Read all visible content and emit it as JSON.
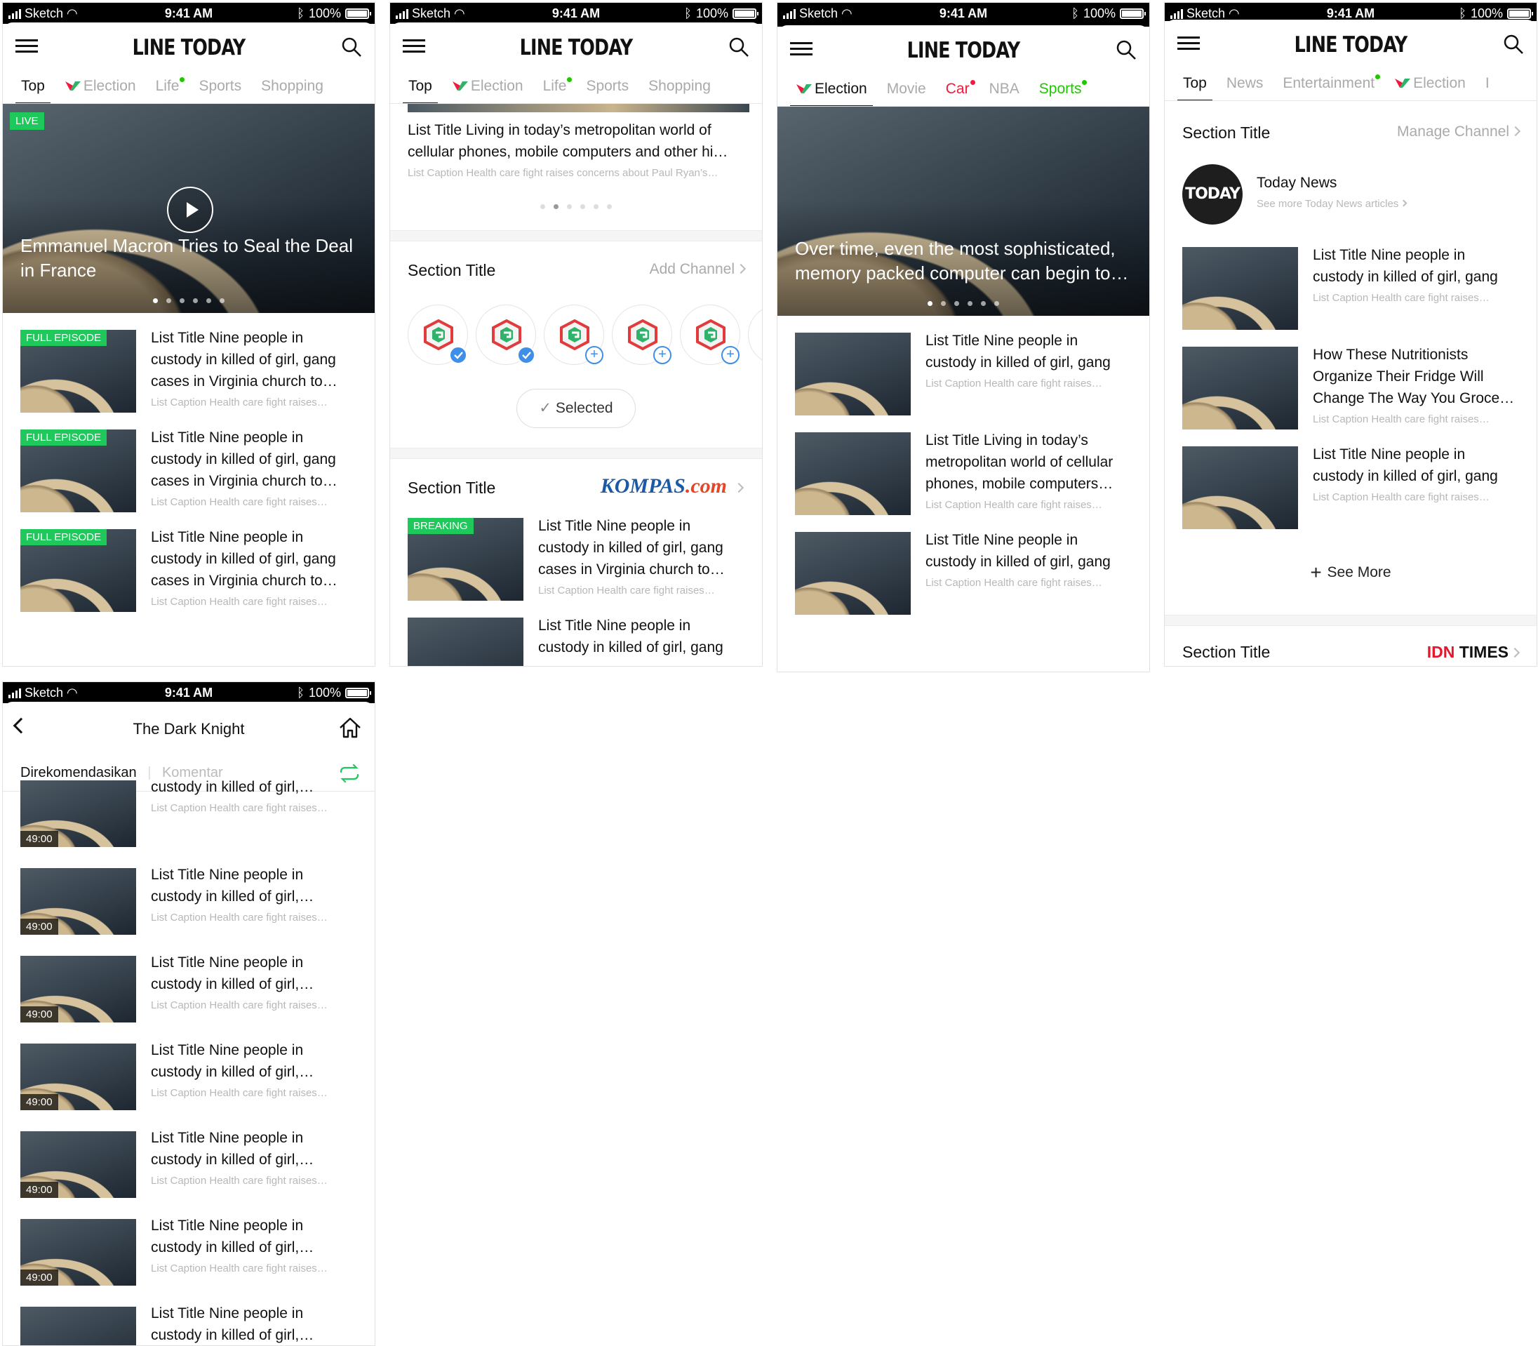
{
  "status": {
    "carrier": "Sketch",
    "time": "9:41 AM",
    "battery": "100%"
  },
  "brand": "LINE TODAY",
  "p1": {
    "tabs": [
      {
        "label": "Top",
        "active": true
      },
      {
        "label": "Election",
        "logo": true
      },
      {
        "label": "Life",
        "dot": "green"
      },
      {
        "label": "Sports"
      },
      {
        "label": "Shopping"
      }
    ],
    "hero": {
      "badge": "LIVE",
      "title": "Emmanuel Macron Tries to Seal the Deal in France",
      "dots": 6,
      "active_dot": 0
    },
    "items": [
      {
        "badge": "FULL EPISODE",
        "title": "List Title Nine people in custody in killed of girl, gang cases in Virginia church to…",
        "caption": "List Caption Health care fight raises…"
      },
      {
        "badge": "FULL EPISODE",
        "title": "List Title Nine people in custody in killed of girl, gang cases in Virginia church to…",
        "caption": "List Caption Health care fight raises…"
      },
      {
        "badge": "FULL EPISODE",
        "title": "List Title Nine people in custody in killed of girl, gang cases in Virginia church to…",
        "caption": "List Caption Health care fight raises…"
      }
    ]
  },
  "p2": {
    "tabs": [
      {
        "label": "Top",
        "active": true
      },
      {
        "label": "Election",
        "logo": true
      },
      {
        "label": "Life",
        "dot": "green"
      },
      {
        "label": "Sports"
      },
      {
        "label": "Shopping"
      }
    ],
    "top_item": {
      "title": "List Title Living in today’s metropolitan world of cellular phones, mobile computers and other hi…",
      "caption": "List Caption Health care fight raises concerns about Paul Ryan’s…",
      "dots": 6,
      "active_dot": 1
    },
    "section1": {
      "title": "Section Title",
      "action": "Add Channel",
      "selected_label": "Selected"
    },
    "section2": {
      "title": "Section Title",
      "publisher_a": "KOMPAS",
      "publisher_b": ".com"
    },
    "items": [
      {
        "badge": "BREAKING",
        "title": "List Title Nine people in custody in killed of girl, gang cases in Virginia church to…",
        "caption": "List Caption Health care fight raises…"
      },
      {
        "title": "List Title Nine people in custody in killed of girl, gang",
        "caption": ""
      }
    ]
  },
  "p3": {
    "tabs": [
      {
        "label": "Election",
        "active": true,
        "logo": true
      },
      {
        "label": "Movie"
      },
      {
        "label": "Car",
        "dot": "red",
        "color": "#f0193e"
      },
      {
        "label": "NBA"
      },
      {
        "label": "Sports",
        "dot": "green",
        "color": "#1ec800"
      }
    ],
    "hero": {
      "title": "Over time, even the most sophisticated, memory packed computer can begin to…",
      "dots": 6,
      "active_dot": 0
    },
    "items": [
      {
        "title": "List Title Nine people in custody in killed of girl, gang",
        "caption": "List Caption Health care fight raises…"
      },
      {
        "title": "List Title Living in today’s metropolitan world of cellular phones, mobile computers…",
        "caption": "List Caption Health care fight raises…"
      },
      {
        "title": "List Title Nine people in custody in killed of girl, gang",
        "caption": "List Caption Health care fight raises…"
      }
    ]
  },
  "p4": {
    "tabs": [
      {
        "label": "Top",
        "active": true
      },
      {
        "label": "News"
      },
      {
        "label": "Entertainment",
        "dot": "green"
      },
      {
        "label": "Election",
        "logo": true
      },
      {
        "label": "I"
      }
    ],
    "section1": {
      "title": "Section Title",
      "action": "Manage Channel"
    },
    "channel": {
      "avatar": "TODAY",
      "name": "Today News",
      "sub": "See more Today News articles"
    },
    "items": [
      {
        "title": "List Title Nine people in custody in killed of girl, gang",
        "caption": "List Caption Health care fight raises…"
      },
      {
        "title": "How These Nutritionists Organize Their Fridge Will Change The Way You Groce…",
        "caption": "List Caption Health care fight raises…"
      },
      {
        "title": "List Title Nine people in custody in killed of girl, gang",
        "caption": "List Caption Health care fight raises…"
      }
    ],
    "see_more": "See More",
    "section2": {
      "title": "Section Title",
      "publisher_a": "IDN",
      "publisher_b": " TIMES"
    }
  },
  "p5": {
    "title": "The Dark Knight",
    "tab_a": "Direkomendasikan",
    "tab_b": "Komentar",
    "items": [
      {
        "title": "custody in killed of girl,…",
        "caption": "List Caption Health care fight raises…",
        "duration": "49:00"
      },
      {
        "title": "List Title Nine people in custody in killed of girl,…",
        "caption": "List Caption Health care fight raises…",
        "duration": "49:00"
      },
      {
        "title": "List Title Nine people in custody in killed of girl,…",
        "caption": "List Caption Health care fight raises…",
        "duration": "49:00"
      },
      {
        "title": "List Title Nine people in custody in killed of girl,…",
        "caption": "List Caption Health care fight raises…",
        "duration": "49:00"
      },
      {
        "title": "List Title Nine people in custody in killed of girl,…",
        "caption": "List Caption Health care fight raises…",
        "duration": "49:00"
      },
      {
        "title": "List Title Nine people in custody in killed of girl,…",
        "caption": "List Caption Health care fight raises…",
        "duration": "49:00"
      },
      {
        "title": "List Title Nine people in custody in killed of girl,…",
        "caption": "",
        "duration": ""
      }
    ]
  },
  "colors": {
    "accent_green": "#1ec85a",
    "dot_red": "#f0193e",
    "link_blue": "#3f8ee8"
  }
}
